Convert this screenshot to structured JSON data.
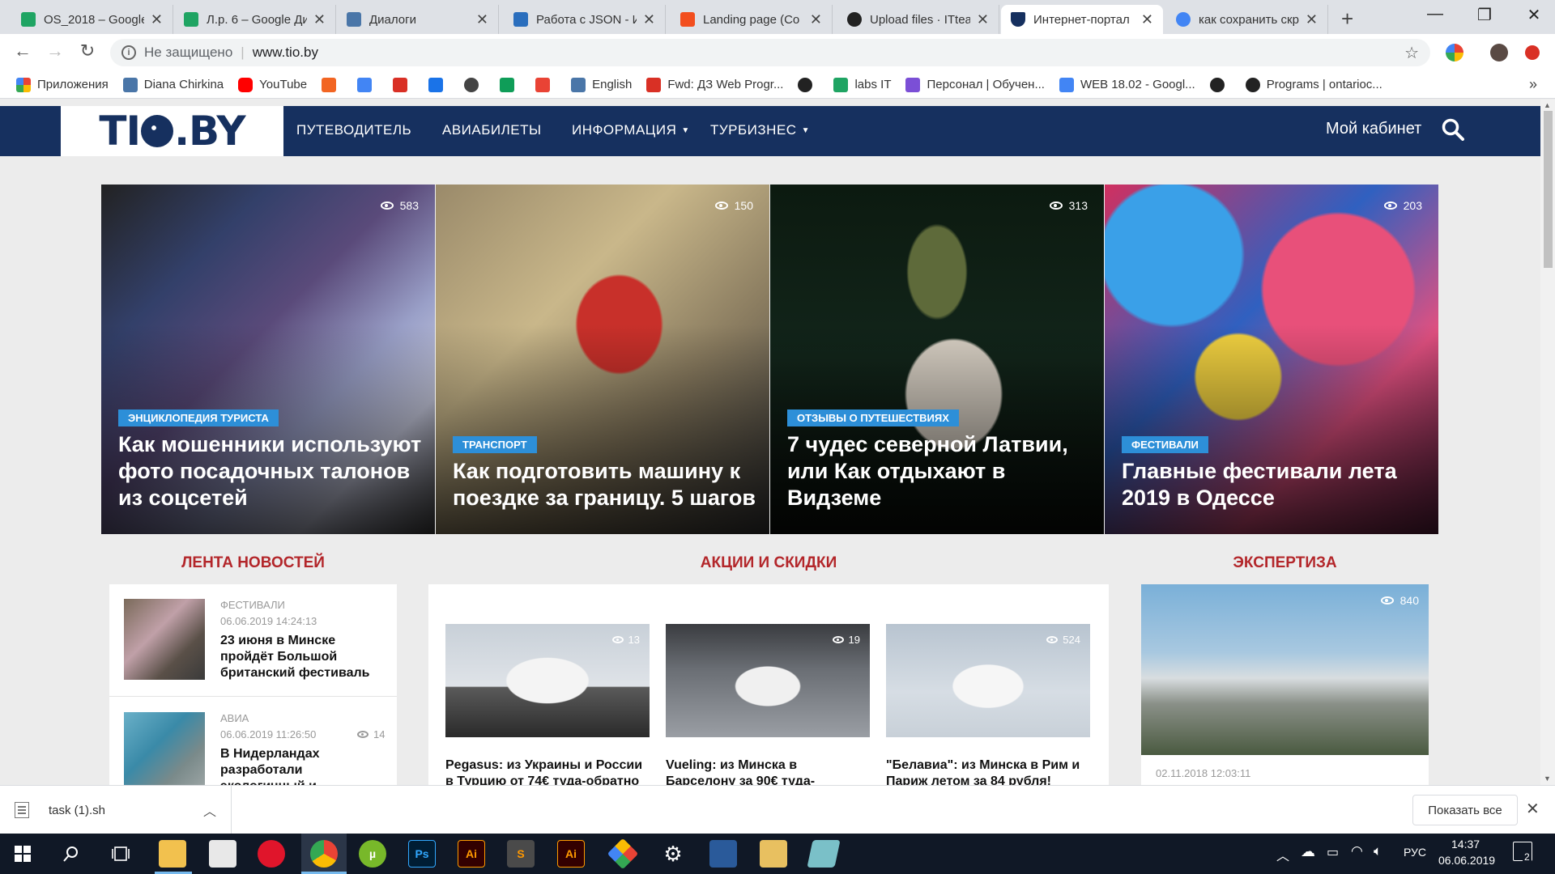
{
  "browser": {
    "tabs": [
      {
        "label": "OS_2018 – Google",
        "color": "#1fa463"
      },
      {
        "label": "Л.р. 6 – Google Ди",
        "color": "#1fa463"
      },
      {
        "label": "Диалоги",
        "color": "#4a76a8"
      },
      {
        "label": "Работа с JSON - И",
        "color": "#2a6ebd"
      },
      {
        "label": "Landing page (Co",
        "color": "#f24e1e"
      },
      {
        "label": "Upload files · ITtea",
        "color": "#222222"
      },
      {
        "label": "Интернет-портал",
        "color": "#16305f"
      },
      {
        "label": "как сохранить скр",
        "color": "#4285f4"
      }
    ],
    "address": {
      "security_label": "Не защищено",
      "url": "www.tio.by"
    },
    "bookmarks": [
      {
        "label": "Приложения",
        "color": "#e94335"
      },
      {
        "label": "Diana Chirkina",
        "color": "#4a76a8"
      },
      {
        "label": "YouTube",
        "color": "#ff0000"
      },
      {
        "label": "",
        "color": "#f26522"
      },
      {
        "label": "",
        "color": "#4285f4"
      },
      {
        "label": "",
        "color": "#d93025"
      },
      {
        "label": "",
        "color": "#1a73e8"
      },
      {
        "label": "",
        "color": "#444444"
      },
      {
        "label": "",
        "color": "#0f9d58"
      },
      {
        "label": "",
        "color": "#e94335"
      },
      {
        "label": "English",
        "color": "#4a76a8"
      },
      {
        "label": "Fwd: ДЗ Web Progr...",
        "color": "#d93025"
      },
      {
        "label": "",
        "color": "#222222"
      },
      {
        "label": "labs IT",
        "color": "#1fa463"
      },
      {
        "label": "Персонал | Обучен...",
        "color": "#7b4fd6"
      },
      {
        "label": "WEB 18.02 - Googl...",
        "color": "#4285f4"
      },
      {
        "label": "",
        "color": "#222222"
      },
      {
        "label": "Programs | ontarioc...",
        "color": "#222222"
      }
    ]
  },
  "site": {
    "logo_text_left": "TI",
    "logo_text_right": ".BY",
    "nav": [
      {
        "label": "ПУТЕВОДИТЕЛЬ"
      },
      {
        "label": "АВИАБИЛЕТЫ"
      },
      {
        "label": "ИНФОРМАЦИЯ"
      },
      {
        "label": "ТУРБИЗНЕС"
      }
    ],
    "cabinet": "Мой кабинет",
    "hero": [
      {
        "views": "583",
        "category": "ЭНЦИКЛОПЕДИЯ ТУРИСТА",
        "title": "Как мошенники используют фото посадочных талонов из соцсетей"
      },
      {
        "views": "150",
        "category": "ТРАНСПОРТ",
        "title": "Как подготовить машину к поездке за границу. 5 шагов"
      },
      {
        "views": "313",
        "category": "ОТЗЫВЫ О ПУТЕШЕСТВИЯХ",
        "title": "7 чудес северной Латвии, или Как отдыхают в Видземе"
      },
      {
        "views": "203",
        "category": "ФЕСТИВАЛИ",
        "title": "Главные фестивали лета 2019 в Одессе"
      }
    ],
    "sections": {
      "news": "ЛЕНТА НОВОСТЕЙ",
      "promos": "АКЦИИ И СКИДКИ",
      "expertise": "ЭКСПЕРТИЗА"
    },
    "news": [
      {
        "category": "ФЕСТИВАЛИ",
        "date": "06.06.2019 14:24:13",
        "views": "",
        "title": "23 июня в Минске пройдёт Большой британский фестиваль"
      },
      {
        "category": "АВИА",
        "date": "06.06.2019 11:26:50",
        "views": "14",
        "title": "В Нидерландах разработали экологичный и"
      }
    ],
    "promos": [
      {
        "views": "13",
        "title": "Pegasus: из Украины и России в Турцию от 74€ туда-обратно"
      },
      {
        "views": "19",
        "title": "Vueling: из Минска в Барселону за 90€ туда-"
      },
      {
        "views": "524",
        "title": "\"Белавиа\": из Минска в Рим и Париж летом за 84 рубля!"
      }
    ],
    "expertise": {
      "views": "840",
      "date": "02.11.2018 12:03:11"
    }
  },
  "downloads": {
    "file": "task (1).sh",
    "show_all": "Показать все"
  },
  "taskbar": {
    "lang": "РУС",
    "time": "14:37",
    "date": "06.06.2019",
    "notifications": "2"
  }
}
